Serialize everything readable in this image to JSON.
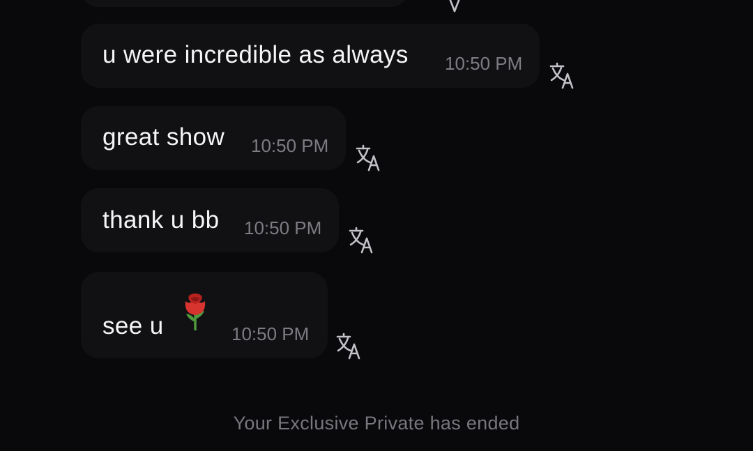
{
  "messages": [
    {
      "text": "u were incredible as always",
      "time": "10:50 PM"
    },
    {
      "text": "great show",
      "time": "10:50 PM"
    },
    {
      "text": "thank u bb",
      "time": "10:50 PM"
    },
    {
      "text": "see u",
      "emoji": "rose",
      "time": "10:50 PM"
    }
  ],
  "icons": {
    "translate": "translate-icon",
    "emoji": "rose-emoji"
  },
  "footer": {
    "status": "Your Exclusive Private has ended"
  },
  "colors": {
    "background": "#09090b",
    "bubble": "#111114",
    "message_text": "#f5f5f7",
    "timestamp": "#7c7c83",
    "icon": "#c2c2c8",
    "rose_petal": "#d8342f",
    "rose_stem": "#4f9a3c"
  }
}
